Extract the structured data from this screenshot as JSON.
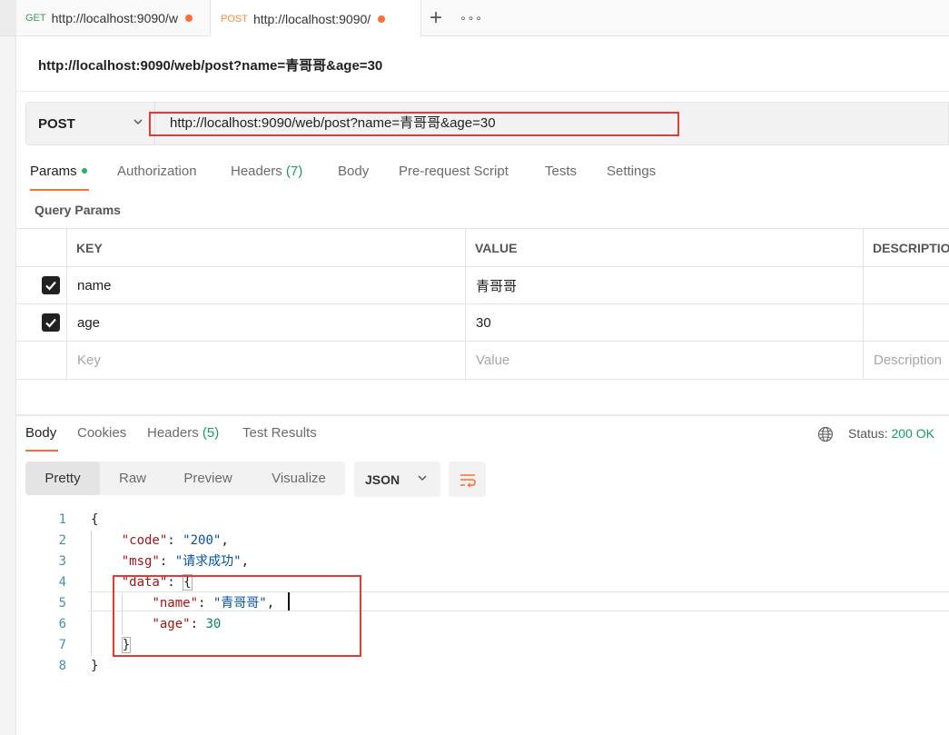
{
  "tabs": [
    {
      "method": "GET",
      "url": "http://localhost:9090/w"
    },
    {
      "method": "POST",
      "url": "http://localhost:9090/"
    }
  ],
  "tab_actions": {
    "add": "+",
    "more": "∘∘∘"
  },
  "request": {
    "name": "http://localhost:9090/web/post?name=青哥哥&age=30",
    "method": "POST",
    "url": "http://localhost:9090/web/post?name=青哥哥&age=30"
  },
  "request_tabs": {
    "params": "Params",
    "authorization": "Authorization",
    "headers": "Headers",
    "headers_count": "(7)",
    "body": "Body",
    "prerequest": "Pre-request Script",
    "tests": "Tests",
    "settings": "Settings"
  },
  "query_params": {
    "title": "Query Params",
    "headers": {
      "key": "KEY",
      "value": "VALUE",
      "description": "DESCRIPTIO"
    },
    "rows": [
      {
        "key": "name",
        "value": "青哥哥"
      },
      {
        "key": "age",
        "value": "30"
      }
    ],
    "placeholders": {
      "key": "Key",
      "value": "Value",
      "description": "Description"
    }
  },
  "response": {
    "tabs": {
      "body": "Body",
      "cookies": "Cookies",
      "headers": "Headers",
      "headers_count": "(5)",
      "test_results": "Test Results"
    },
    "status_label": "Status:",
    "status_value": "200 OK",
    "views": {
      "pretty": "Pretty",
      "raw": "Raw",
      "preview": "Preview",
      "visualize": "Visualize"
    },
    "format": "JSON",
    "code_lines": {
      "l1": {
        "num": "1",
        "brace": "{"
      },
      "l2": {
        "num": "2",
        "key": "\"code\"",
        "value": "\"200\""
      },
      "l3": {
        "num": "3",
        "key": "\"msg\"",
        "value": "\"请求成功\""
      },
      "l4": {
        "num": "4",
        "key": "\"data\"",
        "brace": "{"
      },
      "l5": {
        "num": "5",
        "key": "\"name\"",
        "value": "\"青哥哥\""
      },
      "l6": {
        "num": "6",
        "key": "\"age\"",
        "value": "30"
      },
      "l7": {
        "num": "7",
        "brace": "}"
      },
      "l8": {
        "num": "8",
        "brace": "}"
      }
    }
  },
  "colors": {
    "accent": "#ff6c37",
    "success": "#1a9e5c",
    "highlight_box": "#e53935"
  }
}
